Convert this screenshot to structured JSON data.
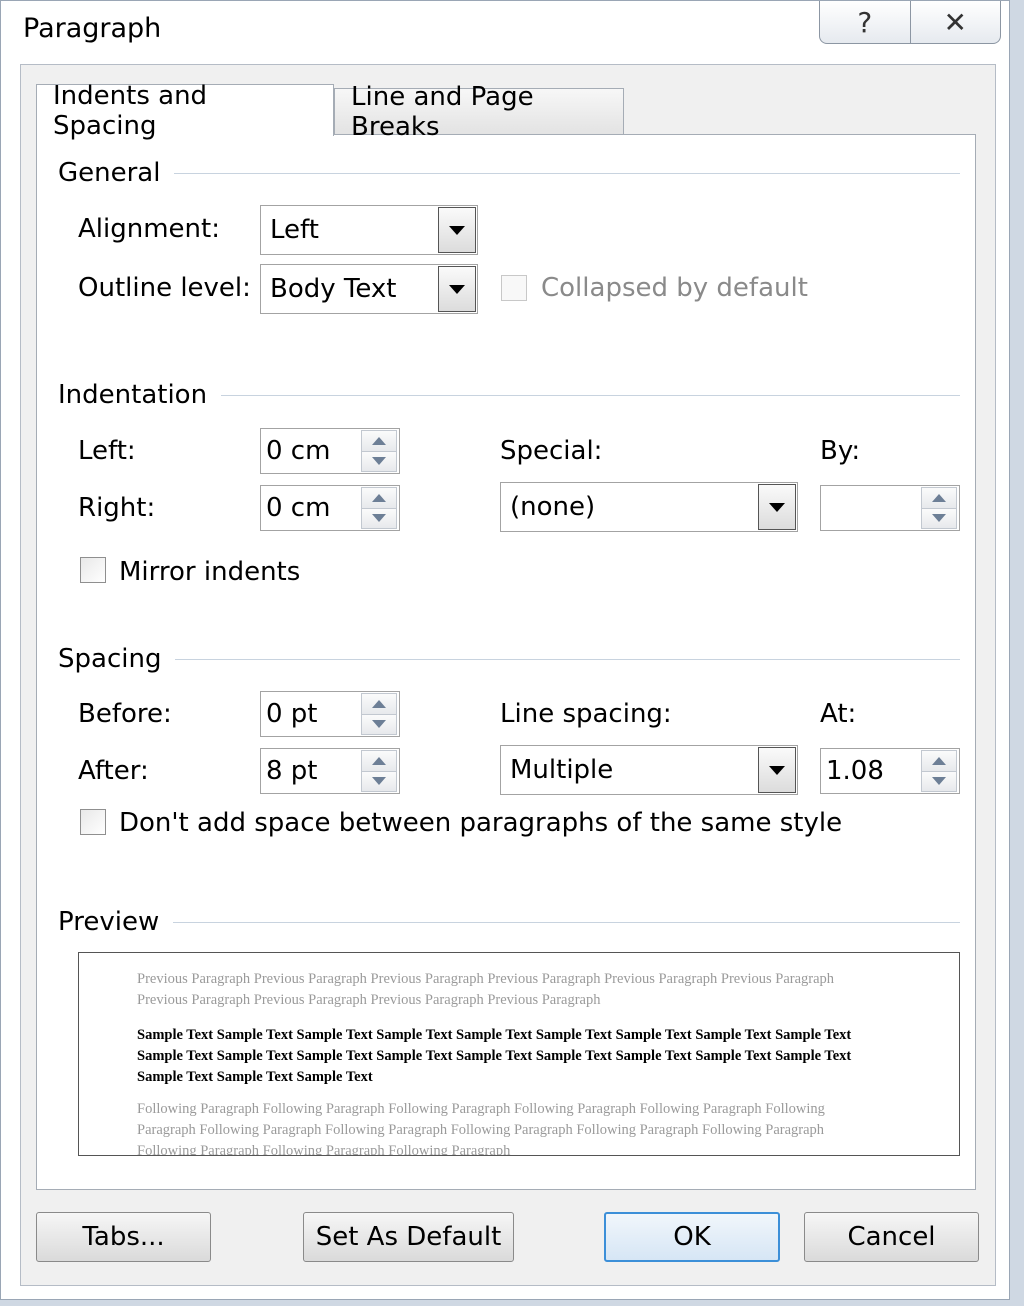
{
  "dialog": {
    "title": "Paragraph",
    "help_icon": "question-mark-icon",
    "close_icon": "close-x-icon"
  },
  "tabs": [
    {
      "label": "Indents and Spacing",
      "active": true
    },
    {
      "label": "Line and Page Breaks",
      "active": false
    }
  ],
  "general": {
    "heading": "General",
    "alignment_label": "Alignment:",
    "alignment_value": "Left",
    "outline_label": "Outline level:",
    "outline_value": "Body Text",
    "collapsed_label": "Collapsed by default"
  },
  "indentation": {
    "heading": "Indentation",
    "left_label": "Left:",
    "left_value": "0 cm",
    "right_label": "Right:",
    "right_value": "0 cm",
    "special_label": "Special:",
    "special_value": "(none)",
    "by_label": "By:",
    "by_value": "",
    "mirror_label": "Mirror indents"
  },
  "spacing": {
    "heading": "Spacing",
    "before_label": "Before:",
    "before_value": "0 pt",
    "after_label": "After:",
    "after_value": "8 pt",
    "line_spacing_label": "Line spacing:",
    "line_spacing_value": "Multiple",
    "at_label": "At:",
    "at_value": "1.08",
    "dont_add_label": "Don't add space between paragraphs of the same style"
  },
  "preview": {
    "heading": "Preview",
    "previous_text": "Previous Paragraph Previous Paragraph Previous Paragraph Previous Paragraph Previous Paragraph Previous Paragraph Previous Paragraph Previous Paragraph Previous Paragraph Previous Paragraph",
    "sample_text": "Sample Text Sample Text Sample Text Sample Text Sample Text Sample Text Sample Text Sample Text Sample Text Sample Text Sample Text Sample Text Sample Text Sample Text Sample Text Sample Text Sample Text Sample Text Sample Text Sample Text Sample Text",
    "following_text": "Following Paragraph Following Paragraph Following Paragraph Following Paragraph Following Paragraph Following Paragraph Following Paragraph Following Paragraph Following Paragraph Following Paragraph Following Paragraph Following Paragraph Following Paragraph Following Paragraph"
  },
  "buttons": {
    "tabs": "Tabs...",
    "set_default": "Set As Default",
    "ok": "OK",
    "cancel": "Cancel"
  }
}
